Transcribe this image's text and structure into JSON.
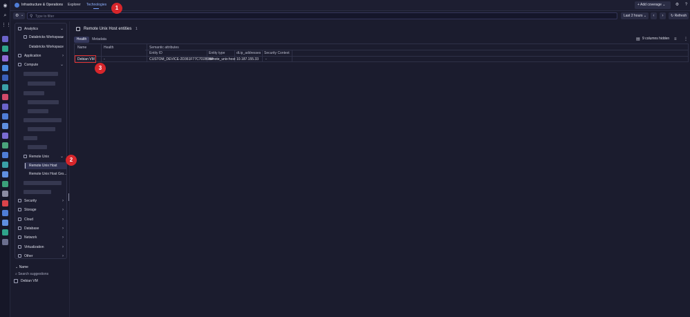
{
  "topbar": {
    "app_title": "Infrastructure & Operations",
    "nav": {
      "explorer": "Explorer",
      "technologies": "Technologies"
    },
    "add_coverage": "Add coverage"
  },
  "filterbar": {
    "placeholder": "Type to filter",
    "timeframe": "Last 2 hours",
    "refresh": "Refresh"
  },
  "sidebar": {
    "sections": {
      "analytics": "Analytics",
      "databricks_workspace": "Databricks Workspace",
      "databricks_workspace_child": "Databricks Workspace",
      "application": "Application",
      "compute": "Compute",
      "remote_unix": "Remote Unix",
      "remote_unix_host": "Remote Unix Host",
      "remote_unix_host_group": "Remote Unix Host Gro...",
      "security": "Security",
      "storage": "Storage",
      "cloud": "Cloud",
      "database": "Database",
      "network": "Network",
      "virtualization": "Virtualization",
      "other": "Other"
    },
    "filter": {
      "name_label": "Name",
      "search_suggestions": "Search suggestions",
      "option": "Debian VM"
    }
  },
  "main": {
    "title": "Remote Unix Host entities",
    "count": "1",
    "tabs": {
      "health": "Health",
      "metadata": "Metadata"
    },
    "columns_hidden": "9 columns hidden",
    "table": {
      "group_header": "Semantic attributes",
      "headers": {
        "name": "Name",
        "health": "Health",
        "entity_id": "Entity ID",
        "entity_type": "Entity type",
        "ip": "dt.ip_addresses",
        "security": "Security Context"
      },
      "row": {
        "name": "Debian VM",
        "health": "-",
        "entity_id": "CUSTOM_DEVICE-2D361F77C7D280BF",
        "entity_type": "remote_unix:host",
        "ip": "10.187.155.33",
        "security": "-"
      }
    }
  },
  "markers": [
    "1",
    "2",
    "3"
  ],
  "colors": {
    "accent": "#7aa3ff",
    "marker": "#d7262b",
    "highlight": "#e03131"
  }
}
